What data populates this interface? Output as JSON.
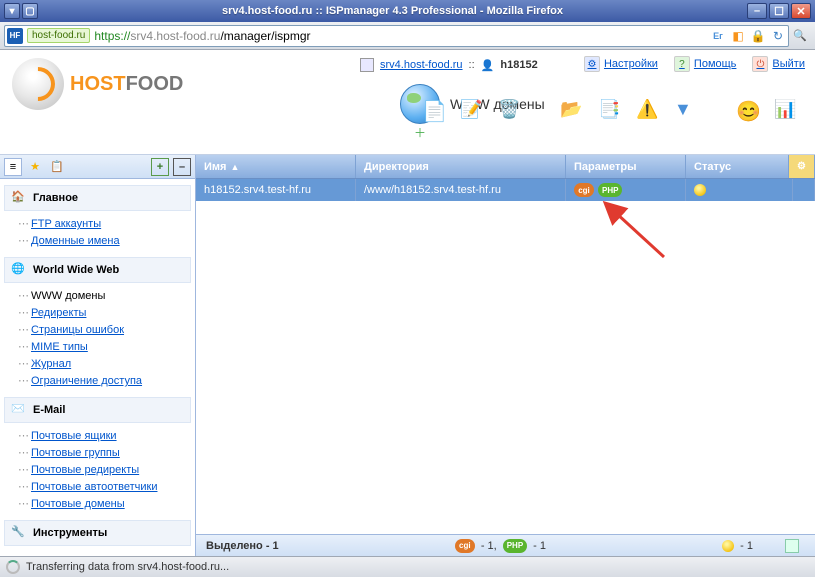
{
  "window": {
    "title": "srv4.host-food.ru :: ISPmanager 4.3 Professional - Mozilla Firefox"
  },
  "url": {
    "favicon": "HF",
    "secure_tag": "host-food.ru",
    "proto": "https://",
    "host": "srv4.host-food.ru",
    "path": "/manager/ispmgr"
  },
  "logo": {
    "part1": "HOST",
    "part2": "FOOD"
  },
  "breadcrumb": {
    "host": "srv4.host-food.ru",
    "sep": "::",
    "user": "h18152"
  },
  "header_links": {
    "settings": "Настройки",
    "help": "Помощь",
    "logout": "Выйти"
  },
  "section": {
    "title": "WWW домены"
  },
  "toolbar": {
    "new": "new-icon",
    "edit": "edit-icon",
    "delete": "delete-icon",
    "goto": "goto-icon",
    "redirect": "redirect-icon",
    "errors": "errors-icon",
    "filter": "filter-icon",
    "smile": "smile-icon",
    "props": "props-icon"
  },
  "sidebar": {
    "tabs": [
      "list",
      "fav",
      "copy",
      "add",
      "collapse"
    ],
    "groups": [
      {
        "title": "Главное",
        "icon": "home-icon",
        "items": [
          "FTP аккаунты",
          "Доменные имена"
        ]
      },
      {
        "title": "World Wide Web",
        "icon": "globe-icon",
        "items": [
          "WWW домены",
          "Редиректы",
          "Страницы ошибок",
          "MIME типы",
          "Журнал",
          "Ограничение доступа"
        ],
        "selected": 0
      },
      {
        "title": "E-Mail",
        "icon": "mail-icon",
        "items": [
          "Почтовые ящики",
          "Почтовые группы",
          "Почтовые редиректы",
          "Почтовые автоответчики",
          "Почтовые домены"
        ]
      },
      {
        "title": "Инструменты",
        "icon": "tools-icon",
        "items": []
      }
    ]
  },
  "grid": {
    "columns": {
      "name": "Имя",
      "dir": "Директория",
      "param": "Параметры",
      "status": "Статус"
    },
    "rows": [
      {
        "name": "h18152.srv4.test-hf.ru",
        "dir": "/www/h18152.srv4.test-hf.ru",
        "badges": [
          "cgi",
          "php"
        ],
        "status": "on"
      }
    ]
  },
  "footer": {
    "selected_label": "Выделено - ",
    "selected_count": "1",
    "cgi_count": " - 1, ",
    "php_count": " - 1",
    "status_count": " - 1"
  },
  "badges": {
    "cgi": "cgi",
    "php": "PHP"
  },
  "statusbar": {
    "text": "Transferring data from srv4.host-food.ru..."
  }
}
